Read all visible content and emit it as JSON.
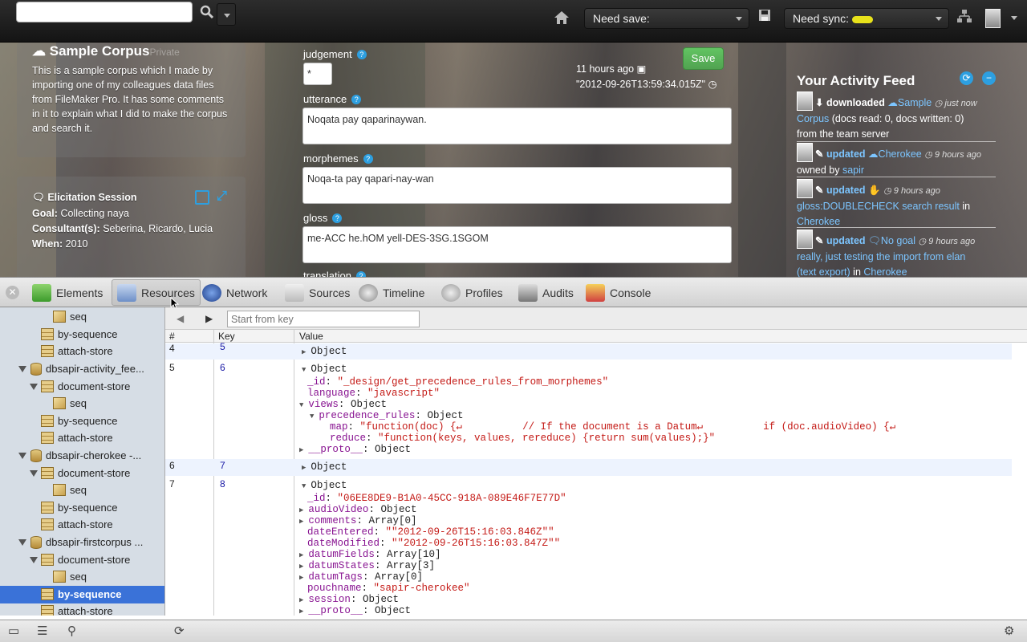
{
  "navbar": {
    "search_placeholder": "",
    "need_save_label": "Need save:",
    "need_sync_label": "Need sync:"
  },
  "corpus": {
    "title": "Sample Corpus",
    "privacy": "Private",
    "description": "This is a sample corpus which I made by importing one of my colleagues data files from FileMaker Pro. It has some comments in it to explain what I did to make the corpus and search it."
  },
  "session": {
    "title": "Elicitation Session",
    "goal_label": "Goal:",
    "goal": "Collecting naya",
    "consultants_label": "Consultant(s):",
    "consultants": "Seberina, Ricardo, Lucia",
    "when_label": "When:",
    "when": "2010"
  },
  "datum": {
    "judgement_label": "judgement",
    "judgement_value": "*",
    "utterance_label": "utterance",
    "utterance_value": "Noqata pay qaparinaywan.",
    "morphemes_label": "morphemes",
    "morphemes_value": "Noqa-ta pay qapari-nay-wan",
    "gloss_label": "gloss",
    "gloss_value": "me-ACC he.hOM yell-DES-3SG.1SGOM",
    "translation_label": "translation",
    "save_label": "Save",
    "time_ago": "11 hours ago",
    "timestamp": "\"2012-09-26T13:59:34.015Z\""
  },
  "feed": {
    "title": "Your Activity Feed",
    "items": [
      {
        "verb": "downloaded",
        "target": "Sample",
        "time": "just now",
        "line2_link": "Corpus",
        "line2_text": " (docs read: 0, docs written: 0)",
        "line3": "from the team server"
      },
      {
        "verb": "updated",
        "target": "Cherokee",
        "time": "9 hours ago",
        "line2_text": "owned by ",
        "line2_link": "sapir"
      },
      {
        "verb": "updated",
        "target": "",
        "time": "9 hours ago",
        "line2_link": "gloss:DOUBLECHECK search result",
        "line2_text": " in",
        "line3_link": "Cherokee"
      },
      {
        "verb": "updated",
        "target": "No goal",
        "time": "9 hours ago",
        "line2_link": "really, just testing the import from elan",
        "line3_link": "(text export)",
        "line3_text": " in ",
        "line3_link2": "Cherokee"
      }
    ]
  },
  "devtools": {
    "tabs": [
      "Elements",
      "Resources",
      "Network",
      "Sources",
      "Timeline",
      "Profiles",
      "Audits",
      "Console"
    ],
    "active_tab": "Resources",
    "start_key_placeholder": "Start from key",
    "columns": [
      "#",
      "Key",
      "Value"
    ],
    "tree": [
      {
        "label": "seq",
        "type": "index"
      },
      {
        "label": "by-sequence",
        "type": "store"
      },
      {
        "label": "attach-store",
        "type": "store"
      },
      {
        "label": "dbsapir-activity_fee...",
        "type": "db"
      },
      {
        "label": "document-store",
        "type": "store"
      },
      {
        "label": "seq",
        "type": "index"
      },
      {
        "label": "by-sequence",
        "type": "store"
      },
      {
        "label": "attach-store",
        "type": "store"
      },
      {
        "label": "dbsapir-cherokee -...",
        "type": "db"
      },
      {
        "label": "document-store",
        "type": "store"
      },
      {
        "label": "seq",
        "type": "index"
      },
      {
        "label": "by-sequence",
        "type": "store"
      },
      {
        "label": "attach-store",
        "type": "store"
      },
      {
        "label": "dbsapir-firstcorpus ...",
        "type": "db"
      },
      {
        "label": "document-store",
        "type": "store"
      },
      {
        "label": "seq",
        "type": "index"
      },
      {
        "label": "by-sequence",
        "type": "store",
        "selected": true
      },
      {
        "label": "attach-store",
        "type": "store"
      }
    ],
    "rows": [
      {
        "num": "4",
        "key": "5",
        "collapsed": "Object"
      },
      {
        "num": "5",
        "key": "6",
        "lines": [
          "Object",
          "_id: \"_design/get_precedence_rules_from_morphemes\"",
          "language: \"javascript\"",
          "views: Object",
          "precedence_rules: Object",
          "map: \"function(doc) {↵          // If the document is a Datum↵          if (doc.audioVideo) {↵",
          "reduce: \"function(keys, values, rereduce) {return sum(values);}\"",
          "__proto__: Object"
        ]
      },
      {
        "num": "6",
        "key": "7",
        "collapsed": "Object"
      },
      {
        "num": "7",
        "key": "8",
        "lines": [
          "Object",
          "_id: \"06EE8DE9-B1A0-45CC-918A-089E46F7E77D\"",
          "audioVideo: Object",
          "comments: Array[0]",
          "dateEntered: \"\"2012-09-26T15:16:03.846Z\"\"",
          "dateModified: \"\"2012-09-26T15:16:03.847Z\"\"",
          "datumFields: Array[10]",
          "datumStates: Array[3]",
          "datumTags: Array[0]",
          "pouchname: \"sapir-cherokee\"",
          "session: Object",
          "__proto__: Object"
        ]
      }
    ]
  }
}
